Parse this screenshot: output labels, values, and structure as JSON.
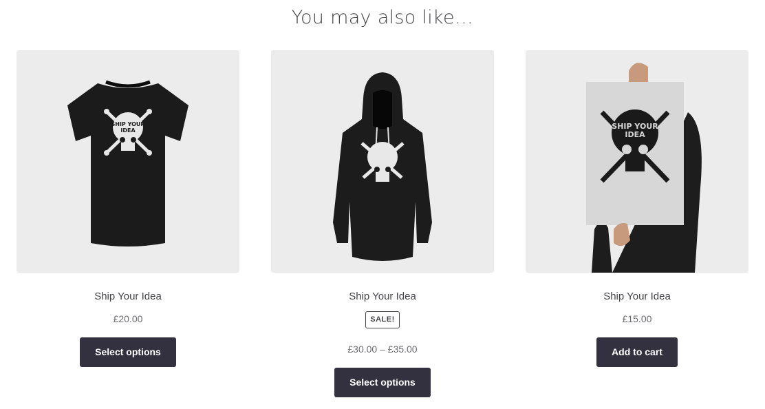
{
  "section": {
    "heading": "You may also like…"
  },
  "products": [
    {
      "title": "Ship Your Idea",
      "price": "£20.00",
      "button_label": "Select options",
      "image": "black t-shirt with skull print"
    },
    {
      "title": "Ship Your Idea",
      "badge": "SALE!",
      "price": "£30.00 – £35.00",
      "button_label": "Select options",
      "image": "black hoodie with skull print"
    },
    {
      "title": "Ship Your Idea",
      "price": "£15.00",
      "button_label": "Add to cart",
      "image": "person holding skull poster"
    }
  ],
  "colors": {
    "button_bg": "#333140",
    "thumb_bg": "#ececec",
    "text": "#43454b"
  }
}
